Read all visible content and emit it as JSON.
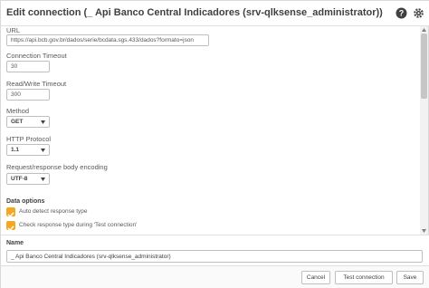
{
  "dialog": {
    "title": "Edit connection (_ Api Banco Central Indicadores (srv-qlksense_administrator))",
    "help_icon": "help-circle-icon",
    "settings_icon": "gear-icon"
  },
  "form": {
    "url_label": "URL",
    "url_value": "https://api.bcb.gov.br/dados/serie/bcdata.sgs.433/dados?formato=json",
    "connection_timeout_label": "Connection Timeout",
    "connection_timeout_value": "30",
    "read_write_timeout_label": "Read/Write Timeout",
    "read_write_timeout_value": "300",
    "method_label": "Method",
    "method_value": "GET",
    "http_protocol_label": "HTTP Protocol",
    "http_protocol_value": "1.1",
    "encoding_label": "Request/response body encoding",
    "encoding_value": "UTF-8"
  },
  "data_options": {
    "title": "Data options",
    "auto_detect_label": "Auto detect response type",
    "auto_detect_checked": true,
    "check_response_label": "Check response type during 'Test connection'",
    "check_response_checked": true
  },
  "name_section": {
    "label": "Name",
    "value": "_ Api Banco Central Indicadores (srv-qlksense_administrator)"
  },
  "footer": {
    "cancel_label": "Cancel",
    "test_label": "Test connection",
    "save_label": "Save"
  },
  "colors": {
    "accent_checkbox": "#f5a623",
    "border": "#bfbfbf",
    "text": "#404040"
  }
}
